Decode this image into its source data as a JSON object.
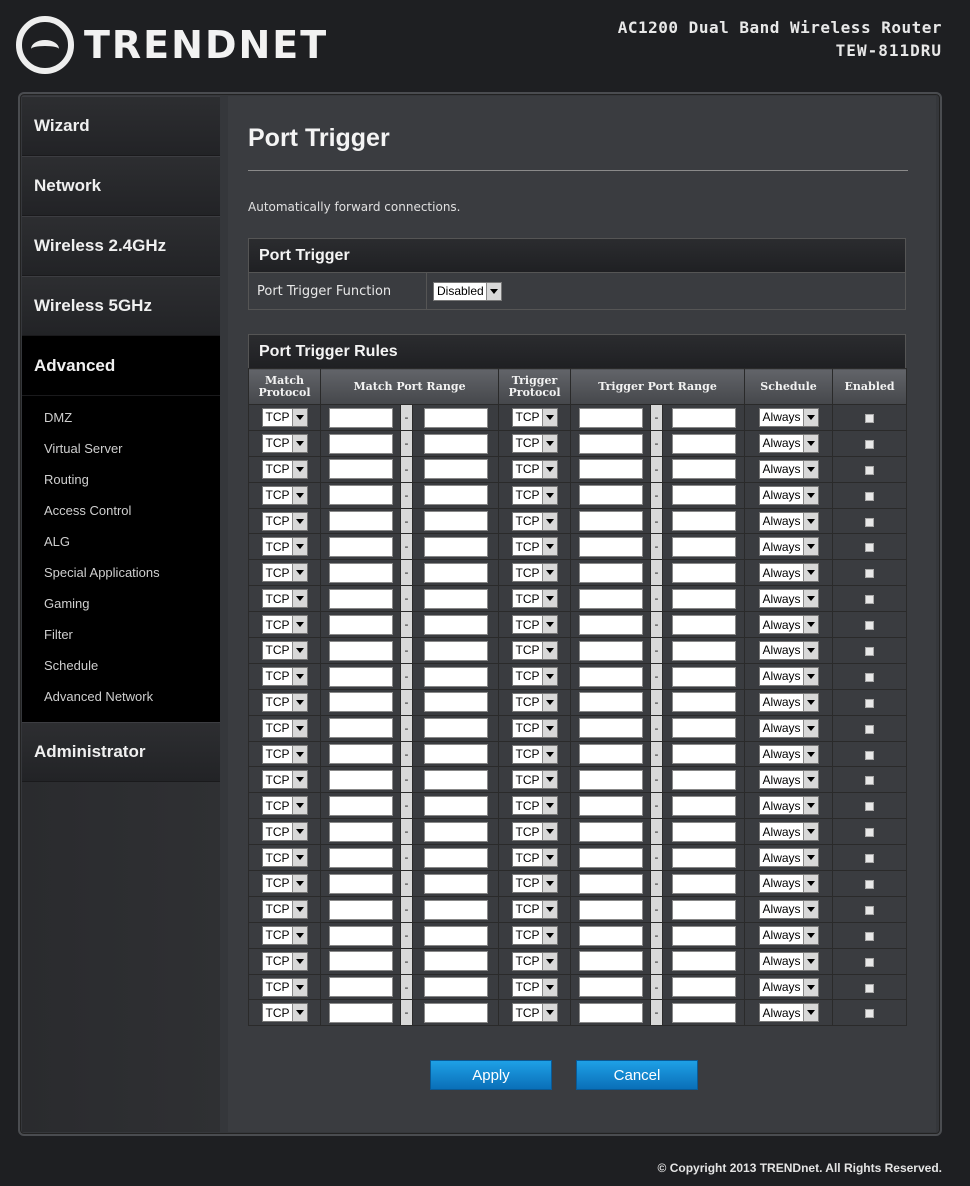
{
  "header": {
    "logo_text": "TRENDNET",
    "product_line1": "AC1200 Dual Band Wireless Router",
    "product_line2": "TEW-811DRU"
  },
  "sidebar": {
    "items": [
      {
        "label": "Wizard"
      },
      {
        "label": "Network"
      },
      {
        "label": "Wireless 2.4GHz"
      },
      {
        "label": "Wireless 5GHz"
      },
      {
        "label": "Advanced",
        "active": true
      },
      {
        "label": "Administrator"
      }
    ],
    "advanced_subitems": [
      "DMZ",
      "Virtual Server",
      "Routing",
      "Access Control",
      "ALG",
      "Special Applications",
      "Gaming",
      "Filter",
      "Schedule",
      "Advanced Network"
    ]
  },
  "main": {
    "title": "Port Trigger",
    "description": "Automatically forward connections.",
    "port_trigger_section": {
      "heading": "Port Trigger",
      "function_label": "Port Trigger Function",
      "function_value": "Disabled"
    },
    "rules_section": {
      "heading": "Port Trigger Rules",
      "columns": {
        "match_protocol_1": "Match",
        "match_protocol_2": "Protocol",
        "match_port_range": "Match Port Range",
        "trigger_protocol_1": "Trigger",
        "trigger_protocol_2": "Protocol",
        "trigger_port_range": "Trigger Port Range",
        "schedule": "Schedule",
        "enabled": "Enabled"
      },
      "row_count": 24,
      "row_defaults": {
        "match_protocol": "TCP",
        "trigger_protocol": "TCP",
        "schedule": "Always",
        "range_separator": "-",
        "enabled": false
      }
    },
    "buttons": {
      "apply": "Apply",
      "cancel": "Cancel"
    }
  },
  "footer": {
    "copyright": "© Copyright 2013 TRENDnet. All Rights Reserved."
  }
}
